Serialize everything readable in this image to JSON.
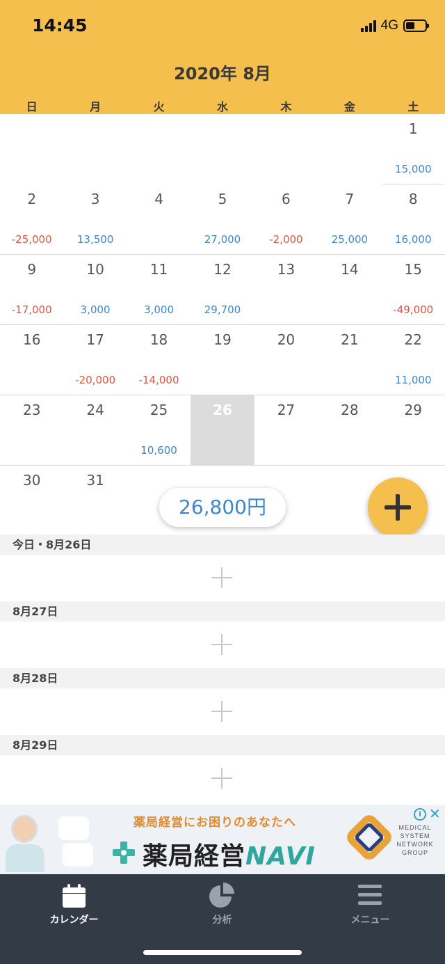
{
  "status": {
    "time": "14:45",
    "network": "4G"
  },
  "calendar": {
    "title": "2020年 8月",
    "weekdays": [
      "日",
      "月",
      "火",
      "水",
      "木",
      "金",
      "土"
    ],
    "weeks": [
      [
        null,
        null,
        null,
        null,
        null,
        null,
        {
          "day": "1",
          "amount": "15,000",
          "sign": "pos"
        }
      ],
      [
        {
          "day": "2",
          "amount": "-25,000",
          "sign": "neg"
        },
        {
          "day": "3",
          "amount": "13,500",
          "sign": "pos"
        },
        {
          "day": "4",
          "amount": "",
          "sign": ""
        },
        {
          "day": "5",
          "amount": "27,000",
          "sign": "pos"
        },
        {
          "day": "6",
          "amount": "-2,000",
          "sign": "neg"
        },
        {
          "day": "7",
          "amount": "25,000",
          "sign": "pos"
        },
        {
          "day": "8",
          "amount": "16,000",
          "sign": "pos"
        }
      ],
      [
        {
          "day": "9",
          "amount": "-17,000",
          "sign": "neg"
        },
        {
          "day": "10",
          "amount": "3,000",
          "sign": "pos"
        },
        {
          "day": "11",
          "amount": "3,000",
          "sign": "pos"
        },
        {
          "day": "12",
          "amount": "29,700",
          "sign": "pos"
        },
        {
          "day": "13",
          "amount": "",
          "sign": ""
        },
        {
          "day": "14",
          "amount": "",
          "sign": ""
        },
        {
          "day": "15",
          "amount": "-49,000",
          "sign": "neg"
        }
      ],
      [
        {
          "day": "16",
          "amount": "",
          "sign": ""
        },
        {
          "day": "17",
          "amount": "-20,000",
          "sign": "neg"
        },
        {
          "day": "18",
          "amount": "-14,000",
          "sign": "neg"
        },
        {
          "day": "19",
          "amount": "",
          "sign": ""
        },
        {
          "day": "20",
          "amount": "",
          "sign": ""
        },
        {
          "day": "21",
          "amount": "",
          "sign": ""
        },
        {
          "day": "22",
          "amount": "11,000",
          "sign": "pos"
        }
      ],
      [
        {
          "day": "23",
          "amount": "",
          "sign": ""
        },
        {
          "day": "24",
          "amount": "",
          "sign": ""
        },
        {
          "day": "25",
          "amount": "10,600",
          "sign": "pos"
        },
        {
          "day": "26",
          "amount": "",
          "sign": "",
          "today": true
        },
        {
          "day": "27",
          "amount": "",
          "sign": ""
        },
        {
          "day": "28",
          "amount": "",
          "sign": ""
        },
        {
          "day": "29",
          "amount": "",
          "sign": ""
        }
      ],
      [
        {
          "day": "30",
          "amount": "",
          "sign": ""
        },
        {
          "day": "31",
          "amount": "",
          "sign": ""
        },
        null,
        null,
        null,
        null,
        null
      ]
    ],
    "total": "26,800円"
  },
  "day_list": [
    {
      "label": "今日・8月26日"
    },
    {
      "label": "8月27日"
    },
    {
      "label": "8月28日"
    },
    {
      "label": "8月29日"
    }
  ],
  "ad": {
    "tagline": "薬局経営にお困りのあなたへ",
    "brand": "薬局経営",
    "brand_accent": "NAVI",
    "company": "MEDICAL SYSTEM NETWORK GROUP",
    "info_glyph": "i",
    "close_glyph": "✕"
  },
  "tabs": [
    {
      "label": "カレンダー",
      "icon": "calendar-icon",
      "active": true
    },
    {
      "label": "分析",
      "icon": "pie-chart-icon",
      "active": false
    },
    {
      "label": "メニュー",
      "icon": "menu-icon",
      "active": false
    }
  ],
  "colors": {
    "header": "#F5BF4D",
    "income": "#3D86D0",
    "expense": "#E2543F",
    "tabbar": "#333B47"
  }
}
